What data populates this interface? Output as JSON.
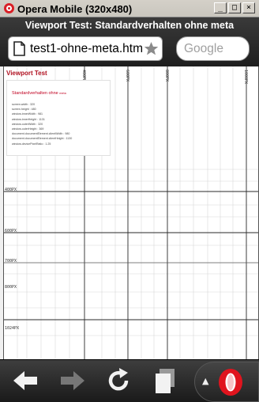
{
  "window": {
    "title": "Opera Mobile (320x480)",
    "controls": {
      "minimize": "_",
      "maximize": "□",
      "close": "×"
    }
  },
  "browser": {
    "page_title": "Viewport Test: Standardverhalten ohne meta",
    "url": "test1-ohne-meta.htm",
    "search_placeholder": "Google",
    "icons": {
      "page": "page-icon",
      "bookmark": "star-icon"
    }
  },
  "page": {
    "heading": "Viewport Test",
    "info_title": "Standardverhalten ohne",
    "info_title_suffix": "meta",
    "info_lines": [
      "screen.width : 320",
      "screen.height : 480",
      "window.innerWidth : 981",
      "window.innerHeight : 1131",
      "window.outerWidth : 320",
      "window.outerHeight : 369",
      "document.documentElement.clientWidth : 980",
      "document.documentElement.clientHeight : 1130",
      "window.devicePixelRatio : 1.25"
    ],
    "ruler_top": [
      "400PX",
      "600PX",
      "800PX",
      "1000PX"
    ],
    "ruler_left": [
      "400PX",
      "600PX",
      "700PX",
      "800PX",
      "1024PX"
    ]
  },
  "toolbar": {
    "back": "back-arrow-icon",
    "forward": "forward-arrow-icon",
    "reload": "reload-icon",
    "tabs": "tabs-icon",
    "menu_arrow": "▲",
    "opera": "opera-logo"
  }
}
